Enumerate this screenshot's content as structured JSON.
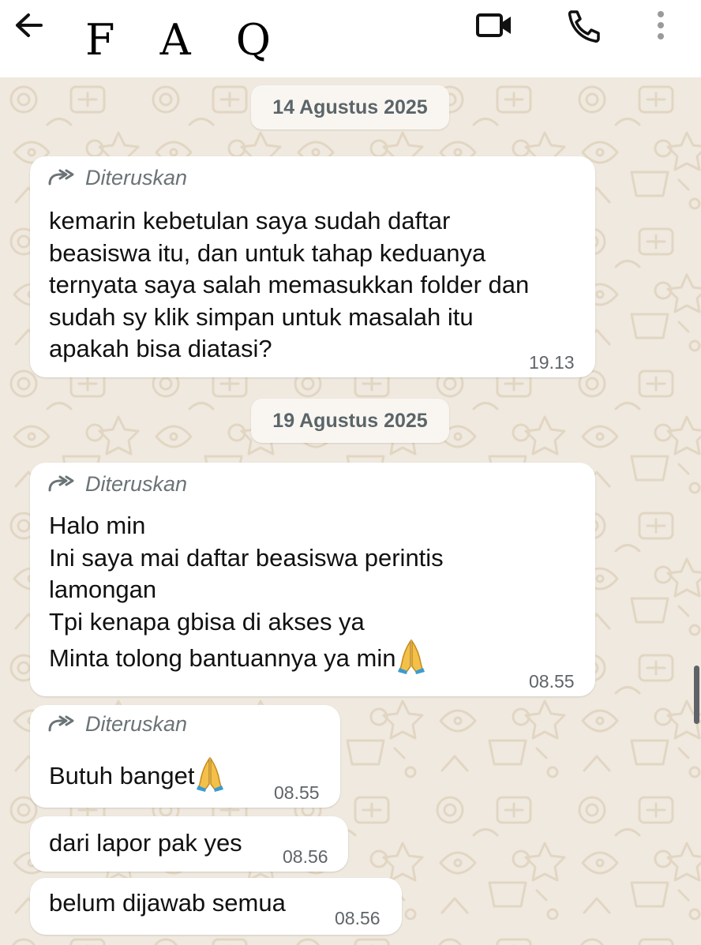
{
  "header": {
    "title": "F A Q",
    "back_icon": "arrow-left-icon",
    "video_icon": "video-camera-icon",
    "call_icon": "phone-icon",
    "menu_icon": "more-vertical-icon"
  },
  "chat": {
    "dates": [
      "14 Agustus 2025",
      "19 Agustus 2025"
    ],
    "forward_label": "Diteruskan",
    "messages": [
      {
        "forwarded": true,
        "lines": [
          "kemarin kebetulan saya sudah daftar",
          "beasiswa itu, dan untuk tahap keduanya",
          "ternyata saya salah memasukkan folder dan",
          "sudah sy klik simpan untuk masalah itu",
          "apakah bisa diatasi?"
        ],
        "time": "19.13"
      },
      {
        "forwarded": true,
        "lines": [
          "Halo min",
          "Ini saya mai daftar beasiswa perintis",
          "lamongan",
          "Tpi kenapa gbisa di akses ya",
          "Minta tolong bantuannya ya min"
        ],
        "emoji": "folded-hands",
        "time": "08.55"
      },
      {
        "forwarded": true,
        "text": "Butuh banget",
        "emoji": "folded-hands",
        "time": "08.55"
      },
      {
        "forwarded": false,
        "text": "dari lapor pak yes",
        "time": "08.56"
      },
      {
        "forwarded": false,
        "text": "belum dijawab semua",
        "time": "08.56"
      }
    ]
  },
  "colors": {
    "header_bg": "#ffffff",
    "chat_bg": "#efe9df",
    "bubble_bg": "#ffffff",
    "doodle": "#e2d6c3",
    "date_text": "#5b6569",
    "meta_text": "#6b7377"
  }
}
